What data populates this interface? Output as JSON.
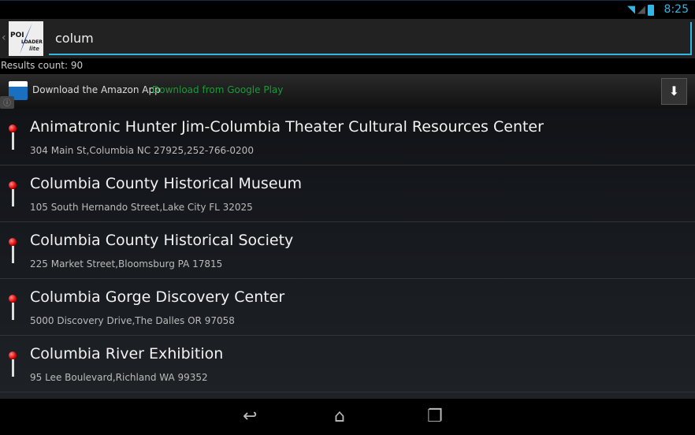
{
  "status": {
    "time": "8:25",
    "icons": [
      "wifi-icon",
      "signal-icon",
      "battery-icon"
    ]
  },
  "search": {
    "value": "colum",
    "logo_text": "POI LOADER lite"
  },
  "results_count": "Results count: 90",
  "ad": {
    "title": "Download the Amazon App",
    "link": "Download from Google Play"
  },
  "items": [
    {
      "name": "Animatronic Hunter Jim-Columbia Theater Cultural Resources Center",
      "address": "304 Main St,Columbia NC 27925,252-766-0200"
    },
    {
      "name": "Columbia County Historical Museum",
      "address": "105 South Hernando Street,Lake City FL 32025"
    },
    {
      "name": "Columbia County Historical Society",
      "address": "225 Market Street,Bloomsburg PA 17815"
    },
    {
      "name": "Columbia Gorge Discovery Center",
      "address": "5000 Discovery Drive,The Dalles OR 97058"
    },
    {
      "name": "Columbia River Exhibition",
      "address": "95 Lee Boulevard,Richland WA 99352"
    }
  ],
  "colors": {
    "accent": "#33b5e5",
    "ad_link": "#1a9a3a"
  }
}
